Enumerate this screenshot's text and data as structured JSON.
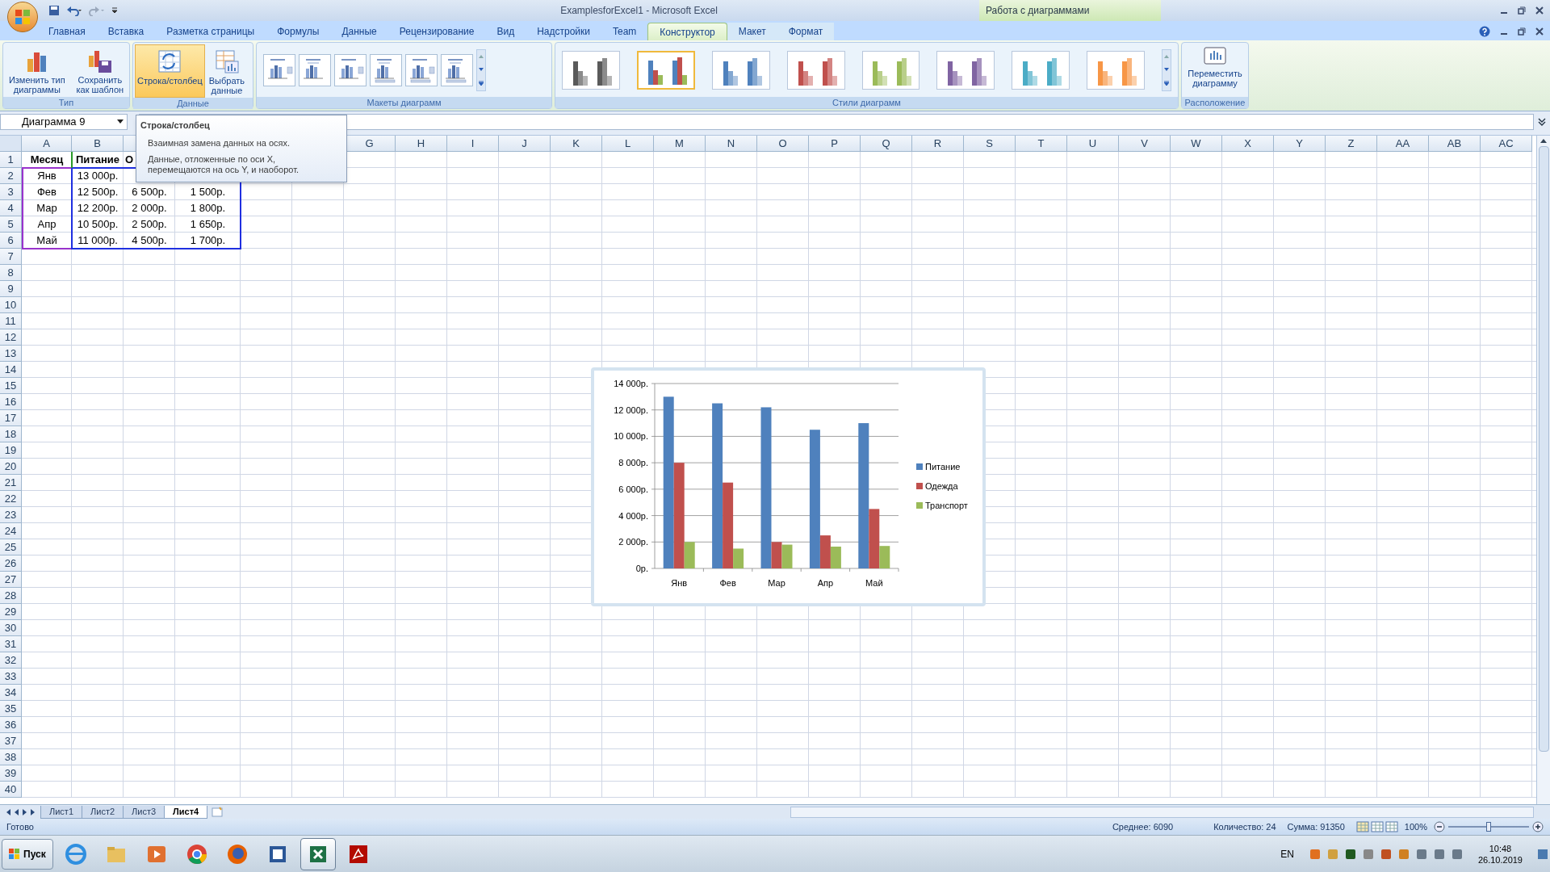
{
  "window": {
    "title": "ExamplesforExcel1 - Microsoft Excel",
    "context_title": "Работа с диаграммами"
  },
  "ribbon_tabs": [
    {
      "label": "Главная",
      "selected": false,
      "contextual": false
    },
    {
      "label": "Вставка",
      "selected": false,
      "contextual": false
    },
    {
      "label": "Разметка страницы",
      "selected": false,
      "contextual": false
    },
    {
      "label": "Формулы",
      "selected": false,
      "contextual": false
    },
    {
      "label": "Данные",
      "selected": false,
      "contextual": false
    },
    {
      "label": "Рецензирование",
      "selected": false,
      "contextual": false
    },
    {
      "label": "Вид",
      "selected": false,
      "contextual": false
    },
    {
      "label": "Надстройки",
      "selected": false,
      "contextual": false
    },
    {
      "label": "Team",
      "selected": false,
      "contextual": false
    },
    {
      "label": "Конструктор",
      "selected": true,
      "contextual": true
    },
    {
      "label": "Макет",
      "selected": false,
      "contextual": true
    },
    {
      "label": "Формат",
      "selected": false,
      "contextual": true
    }
  ],
  "ribbon": {
    "type_group": {
      "label": "Тип",
      "buttons": [
        {
          "label": "Изменить тип\nдиаграммы",
          "kind": "change"
        },
        {
          "label": "Сохранить\nкак шаблон",
          "kind": "save"
        }
      ]
    },
    "data_group": {
      "label": "Данные",
      "buttons": [
        {
          "label": "Строка/столбец",
          "kind": "switch",
          "selected": true
        },
        {
          "label": "Выбрать\nданные",
          "kind": "select",
          "selected": false
        }
      ]
    },
    "layouts_group": {
      "label": "Макеты диаграмм"
    },
    "styles_group": {
      "label": "Стили диаграмм",
      "styles": [
        {
          "kind": "mono",
          "color": "#5a5a5a",
          "selected": false
        },
        {
          "kind": "multi",
          "color": "#4f81bd",
          "selected": true
        },
        {
          "kind": "mono",
          "color": "#4f81bd",
          "selected": false
        },
        {
          "kind": "mono",
          "color": "#c0504d",
          "selected": false
        },
        {
          "kind": "mono",
          "color": "#9bbb59",
          "selected": false
        },
        {
          "kind": "mono",
          "color": "#8064a2",
          "selected": false
        },
        {
          "kind": "mono",
          "color": "#4bacc6",
          "selected": false
        },
        {
          "kind": "mono",
          "color": "#f79646",
          "selected": false
        }
      ]
    },
    "location_group": {
      "label": "Расположение",
      "button": "Переместить\nдиаграмму"
    }
  },
  "name_box": "Диаграмма 9",
  "tooltip": {
    "title": "Строка/столбец",
    "lines": [
      "Взаимная замена данных на осях.",
      "Данные, отложенные по оси X,\nперемещаются на ось Y, и наоборот."
    ]
  },
  "columns": [
    "A",
    "B",
    "",
    "",
    "",
    "",
    "G",
    "H",
    "I",
    "J",
    "K",
    "L",
    "M",
    "N",
    "O",
    "P",
    "Q",
    "R",
    "S",
    "T",
    "U",
    "V",
    "W",
    "X",
    "Y",
    "Z",
    "AA",
    "AB",
    "AC"
  ],
  "row_numbers": [
    "1",
    "2",
    "3",
    "4",
    "5",
    "6",
    "7",
    "8",
    "9",
    "10",
    "11",
    "12",
    "13",
    "14",
    "15",
    "16",
    "17",
    "18",
    "19",
    "20",
    "21",
    "22",
    "23",
    "24",
    "25",
    "26",
    "27",
    "28",
    "29",
    "30",
    "31",
    "32",
    "33",
    "34",
    "35",
    "36",
    "37",
    "38",
    "39",
    "40"
  ],
  "cells": [
    [
      "Месяц",
      "Питание",
      "О",
      ""
    ],
    [
      "Янв",
      "13 000р.",
      "",
      ""
    ],
    [
      "Фев",
      "12 500р.",
      "6 500р.",
      "1 500р."
    ],
    [
      "Мар",
      "12 200р.",
      "2 000р.",
      "1 800р."
    ],
    [
      "Апр",
      "10 500р.",
      "2 500р.",
      "1 650р."
    ],
    [
      "Май",
      "11 000р.",
      "4 500р.",
      "1 700р."
    ]
  ],
  "chart": {
    "chart_data": {
      "type": "bar",
      "categories": [
        "Янв",
        "Фев",
        "Мар",
        "Апр",
        "Май"
      ],
      "series": [
        {
          "name": "Питание",
          "color": "#4f81bd",
          "values": [
            13000,
            12500,
            12200,
            10500,
            11000
          ]
        },
        {
          "name": "Одежда",
          "color": "#c0504d",
          "values": [
            8000,
            6500,
            2000,
            2500,
            4500
          ]
        },
        {
          "name": "Транспорт",
          "color": "#9bbb59",
          "values": [
            2000,
            1500,
            1800,
            1650,
            1700
          ]
        }
      ],
      "ylim": [
        0,
        14000
      ],
      "grid": true,
      "legend": true,
      "yticks": [
        {
          "value": 0,
          "label": "0р."
        },
        {
          "value": 2000,
          "label": "2 000р."
        },
        {
          "value": 4000,
          "label": "4 000р."
        },
        {
          "value": 6000,
          "label": "6 000р."
        },
        {
          "value": 8000,
          "label": "8 000р."
        },
        {
          "value": 10000,
          "label": "10 000р."
        },
        {
          "value": 12000,
          "label": "12 000р."
        },
        {
          "value": 14000,
          "label": "14 000р."
        }
      ]
    }
  },
  "sheet_tabs": [
    {
      "label": "Лист1",
      "selected": false
    },
    {
      "label": "Лист2",
      "selected": false
    },
    {
      "label": "Лист3",
      "selected": false
    },
    {
      "label": "Лист4",
      "selected": true
    }
  ],
  "status_bar": {
    "state": "Готово",
    "average": "Среднее: 6090",
    "count": "Количество: 24",
    "sum": "Сумма: 91350",
    "zoom": {
      "reading": "100%",
      "level": 0.5
    }
  },
  "taskbar": {
    "start": "Пуск",
    "apps": [
      {
        "kind": "browser",
        "selected": false
      },
      {
        "kind": "folder",
        "selected": false
      },
      {
        "kind": "player",
        "selected": false
      },
      {
        "kind": "chrome",
        "selected": false
      },
      {
        "kind": "firefox",
        "selected": false
      },
      {
        "kind": "word",
        "selected": false
      },
      {
        "kind": "excel",
        "selected": true
      },
      {
        "kind": "pdf",
        "selected": false
      }
    ],
    "language": "EN",
    "time": "10:48",
    "date": "26.10.2019"
  }
}
